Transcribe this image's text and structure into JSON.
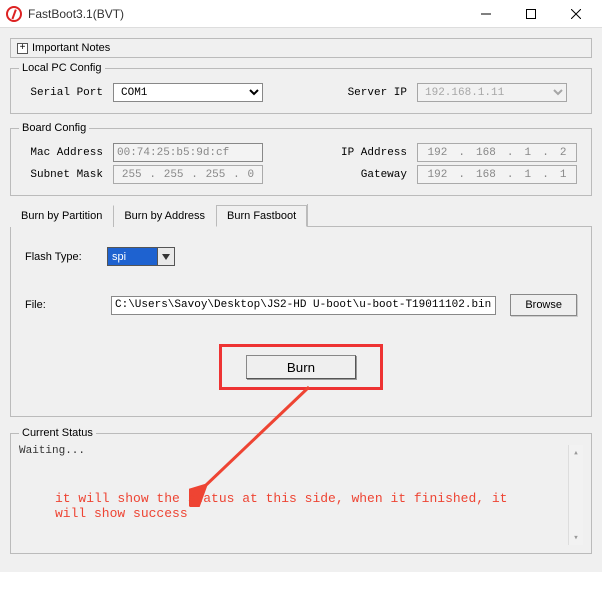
{
  "window": {
    "title": "FastBoot3.1(BVT)"
  },
  "important_notes": {
    "label": "Important Notes"
  },
  "local_pc_config": {
    "legend": "Local PC Config",
    "serial_port_label": "Serial Port",
    "serial_port_value": "COM1",
    "server_ip_label": "Server IP",
    "server_ip_value": "192.168.1.11"
  },
  "board_config": {
    "legend": "Board Config",
    "mac_label": "Mac Address",
    "mac_value": "00:74:25:b5:9d:cf",
    "ip_label": "IP Address",
    "ip_parts": [
      "192",
      "168",
      "1",
      "2"
    ],
    "subnet_label": "Subnet Mask",
    "subnet_parts": [
      "255",
      "255",
      "255",
      "0"
    ],
    "gateway_label": "Gateway",
    "gateway_parts": [
      "192",
      "168",
      "1",
      "1"
    ]
  },
  "tabs": {
    "t0": "Burn by Partition",
    "t1": "Burn by Address",
    "t2": "Burn Fastboot"
  },
  "fastboot": {
    "flash_type_label": "Flash Type:",
    "flash_type_value": "spi",
    "file_label": "File:",
    "file_value": "C:\\Users\\Savoy\\Desktop\\JS2-HD U-boot\\u-boot-T19011102.bin",
    "browse_label": "Browse",
    "burn_label": "Burn"
  },
  "status": {
    "legend": "Current Status",
    "text": "Waiting...",
    "annotation": "it will show the status at this side, when it finished, it will show success"
  }
}
